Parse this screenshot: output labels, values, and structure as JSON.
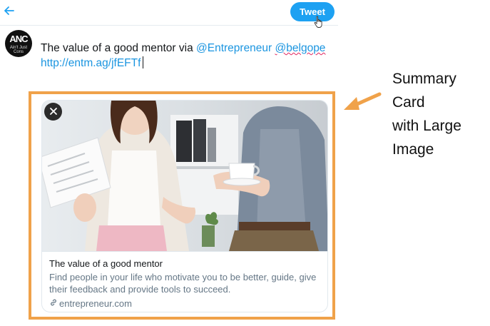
{
  "header": {
    "tweet_label": "Tweet"
  },
  "avatar": {
    "text": "ANC",
    "sub": "Ain't Just Cons"
  },
  "compose": {
    "text": "The value of a good mentor via ",
    "mention1": "@Entrepreneur",
    "mention2": "@belgope",
    "link": "http://entm.ag/jfEFTf"
  },
  "card": {
    "title": "The value of a good mentor",
    "description": "Find people in your life who motivate you to be better, guide, give their feedback and provide tools to succeed.",
    "domain": "entrepreneur.com"
  },
  "annotation": {
    "lines": [
      "Summary Card",
      "with Large",
      "Image"
    ]
  },
  "colors": {
    "accent": "#1da1f2",
    "highlight": "#f0a24a"
  }
}
